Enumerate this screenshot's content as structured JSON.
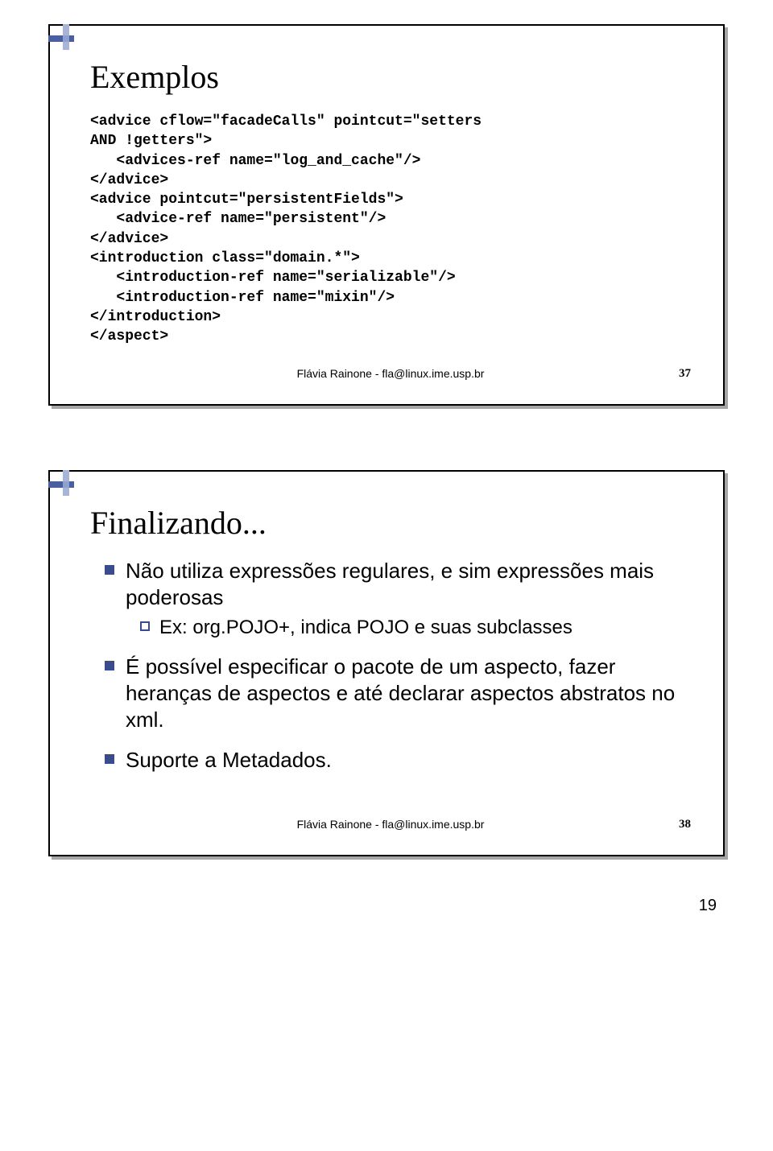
{
  "slide1": {
    "title": "Exemplos",
    "code": "<advice cflow=\"facadeCalls\" pointcut=\"setters\nAND !getters\">\n   <advices-ref name=\"log_and_cache\"/>\n</advice>\n<advice pointcut=\"persistentFields\">\n   <advice-ref name=\"persistent\"/>\n</advice>\n<introduction class=\"domain.*\">\n   <introduction-ref name=\"serializable\"/>\n   <introduction-ref name=\"mixin\"/>\n</introduction>\n</aspect>",
    "footer_author": "Flávia Rainone - fla@linux.ime.usp.br",
    "footer_page": "37"
  },
  "slide2": {
    "title": "Finalizando...",
    "b1a": "Não utiliza expressões regulares, e sim expressões mais poderosas",
    "b2a": "Ex: org.POJO+, indica POJO e suas subclasses",
    "b1b": "É possível especificar o pacote de um aspecto, fazer heranças de aspectos e até declarar aspectos abstratos no xml.",
    "b1c": "Suporte a Metadados.",
    "footer_author": "Flávia Rainone - fla@linux.ime.usp.br",
    "footer_page": "38"
  },
  "page_number": "19"
}
